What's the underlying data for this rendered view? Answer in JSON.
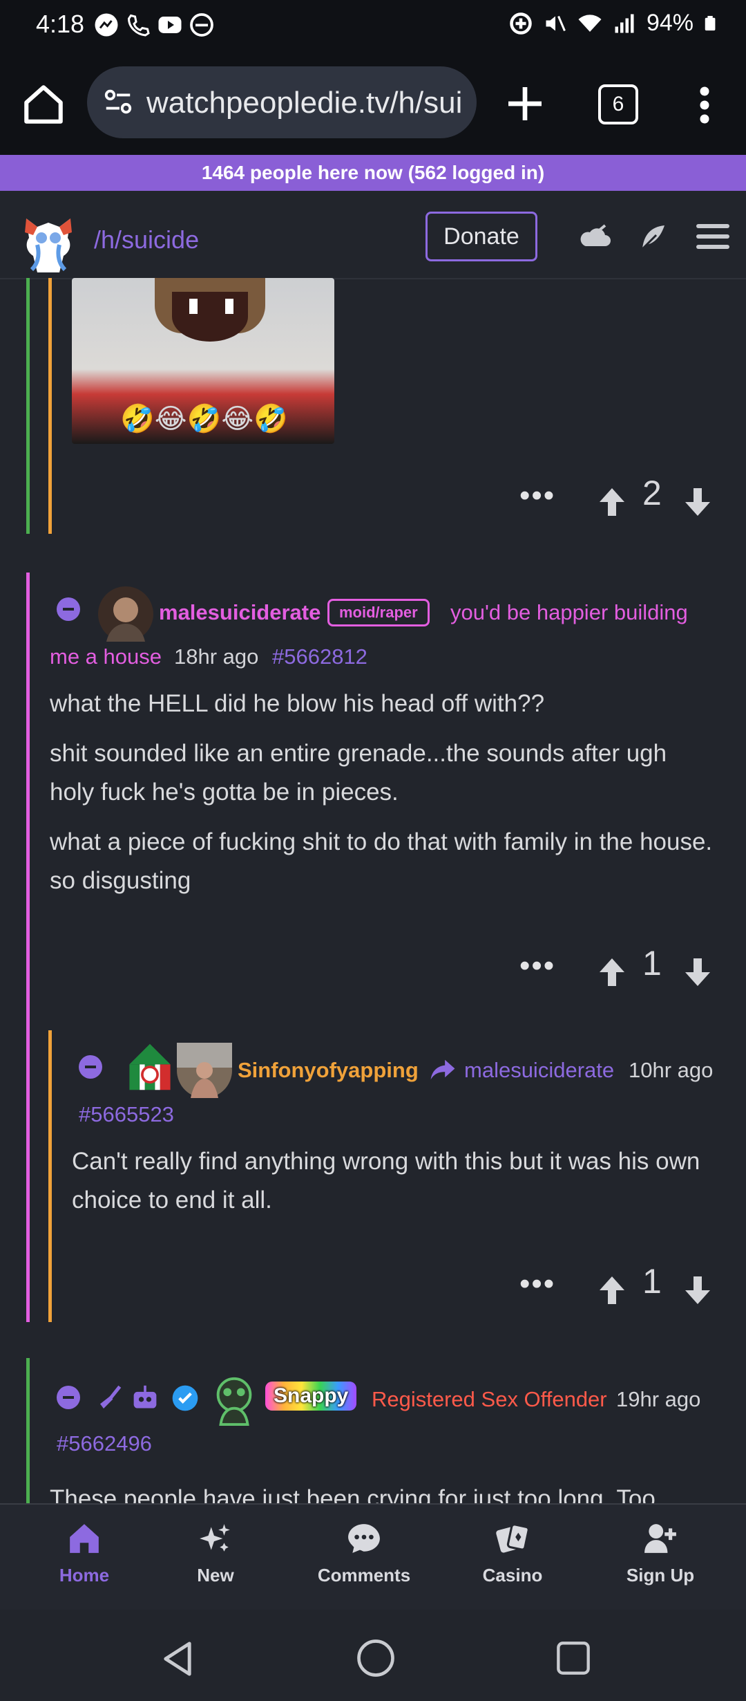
{
  "status_bar": {
    "time": "4:18",
    "battery": "94%"
  },
  "browser": {
    "url": "watchpeopledie.tv/h/sui",
    "tab_count": "6"
  },
  "banner": {
    "online_text": "1464 people here now (562 logged in)"
  },
  "header": {
    "hole": "/h/suicide",
    "donate_label": "Donate"
  },
  "post_top": {
    "score": "2",
    "emojis": "🤣😂🤣😂🤣"
  },
  "comments": [
    {
      "username": "malesuiciderate",
      "flair_badge": "moid/raper",
      "flair_text_1": "you'd be happier building",
      "flair_text_2": "me a house",
      "time": "18hr ago",
      "id": "#5662812",
      "paragraphs": [
        "what the HELL did he blow his head off with??",
        "shit sounded like an entire grenade...the sounds after ugh holy fuck he's gotta be in pieces.",
        "what a piece of fucking shit to do that with family in the house. so disgusting"
      ],
      "score": "1"
    },
    {
      "username": "Sinfonyofyapping",
      "reply_to": "malesuiciderate",
      "time": "10hr ago",
      "id": "#5665523",
      "paragraphs": [
        "Can't really find anything wrong with this but it was his own choice to end it all."
      ],
      "score": "1"
    },
    {
      "badge": "Snappy",
      "flair": "Registered Sex Offender",
      "time": "19hr ago",
      "id": "#5662496",
      "preview": "These people have just been crying for just too long. Too"
    }
  ],
  "nav": {
    "home": "Home",
    "new": "New",
    "comments": "Comments",
    "casino": "Casino",
    "signup": "Sign Up"
  },
  "colors": {
    "accent": "#8d6ae0",
    "pink": "#e35ee0",
    "orange": "#f0a23a",
    "red": "#ff5a4a"
  },
  "icons": [
    "messenger-icon",
    "phone-icon",
    "youtube-icon",
    "dnd-icon",
    "data-saver-icon",
    "mute-icon",
    "wifi-icon",
    "signal-icon",
    "battery-icon",
    "home-icon",
    "tune-icon",
    "plus-icon",
    "more-icon",
    "upvote-icon",
    "downvote-icon",
    "share-icon",
    "broom-icon",
    "robot-icon",
    "verified-icon"
  ]
}
